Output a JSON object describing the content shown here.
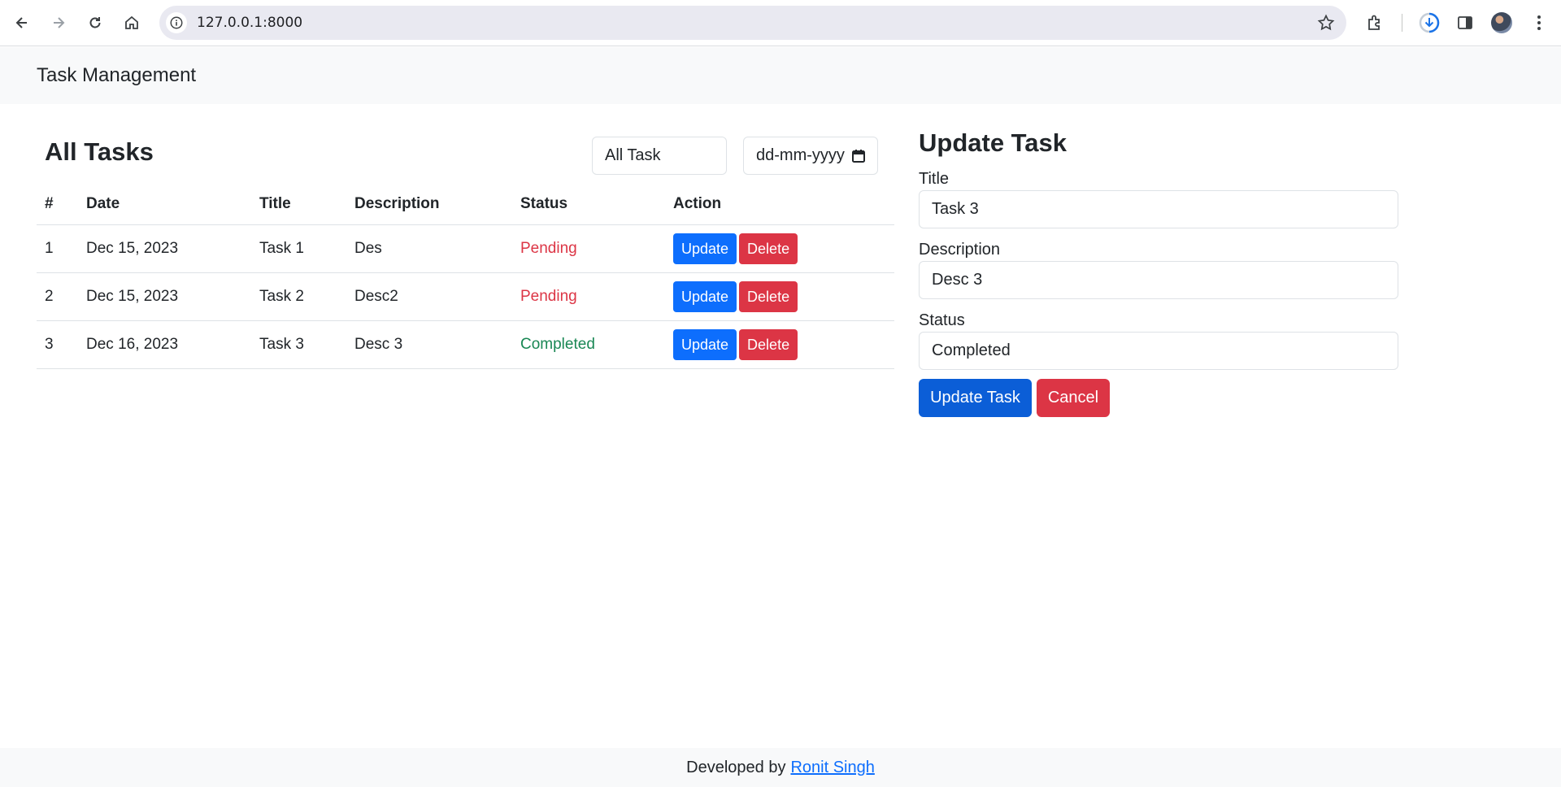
{
  "browser": {
    "url": "127.0.0.1:8000"
  },
  "navbar": {
    "brand": "Task Management"
  },
  "task_list": {
    "title": "All Tasks",
    "filter_status": "All Task",
    "filter_date_placeholder": "dd-mm-yyyy",
    "columns": [
      "#",
      "Date",
      "Title",
      "Description",
      "Status",
      "Action"
    ],
    "rows": [
      {
        "num": "1",
        "date": "Dec 15, 2023",
        "title": "Task 1",
        "description": "Des",
        "status": "Pending",
        "update": "Update",
        "delete": "Delete"
      },
      {
        "num": "2",
        "date": "Dec 15, 2023",
        "title": "Task 2",
        "description": "Desc2",
        "status": "Pending",
        "update": "Update",
        "delete": "Delete"
      },
      {
        "num": "3",
        "date": "Dec 16, 2023",
        "title": "Task 3",
        "description": "Desc 3",
        "status": "Completed",
        "update": "Update",
        "delete": "Delete"
      }
    ]
  },
  "update_form": {
    "title": "Update Task",
    "title_label": "Title",
    "title_value": "Task 3",
    "description_label": "Description",
    "description_value": "Desc 3",
    "status_label": "Status",
    "status_value": "Completed",
    "submit_label": "Update Task",
    "cancel_label": "Cancel"
  },
  "footer": {
    "text": "Developed by",
    "author": "Ronit Singh"
  },
  "colors": {
    "primary": "#0d6efd",
    "update_task_button": "#0b5ed7",
    "danger": "#dc3545",
    "success": "#198754",
    "navbar_bg": "#f8f9fa"
  }
}
